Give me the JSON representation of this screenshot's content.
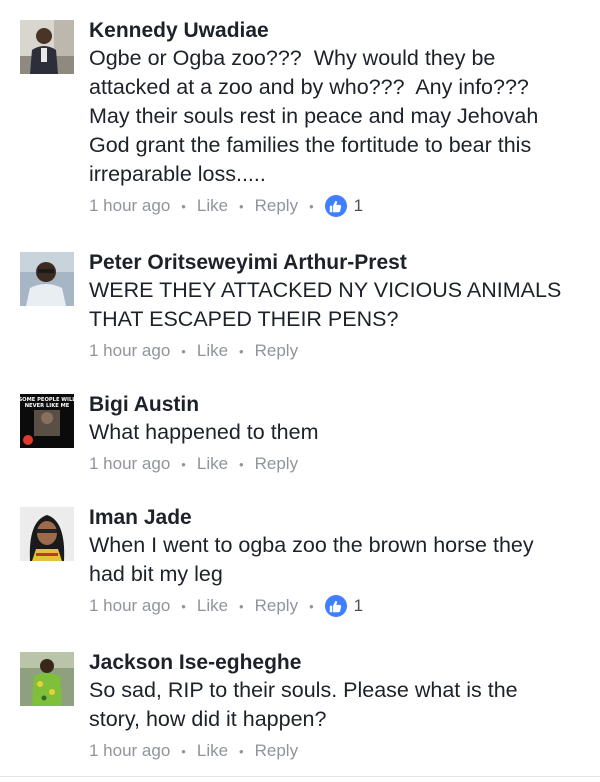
{
  "accent_color": "#4080ff",
  "comments": [
    {
      "author": "Kennedy Uwadiae",
      "text": "Ogbe or Ogba zoo???  Why would they be\nattacked at a zoo and by who???  Any info???\nMay their souls rest in peace and may Jehovah\nGod grant the families the fortitude to bear this\nirreparable loss.....",
      "time": "1 hour ago",
      "like_label": "Like",
      "reply_label": "Reply",
      "reactions": "1",
      "avatar_icon": "profile-photo-man-office"
    },
    {
      "author": "Peter Oritseweyimi Arthur-Prest",
      "text": "WERE THEY ATTACKED NY VICIOUS ANIMALS\nTHAT ESCAPED THEIR PENS?",
      "time": "1 hour ago",
      "like_label": "Like",
      "reply_label": "Reply",
      "avatar_icon": "profile-photo-man-glasses"
    },
    {
      "author": "Bigi Austin",
      "text": "What happened to them",
      "time": "1 hour ago",
      "like_label": "Like",
      "reply_label": "Reply",
      "avatar_icon": "profile-photo-meme",
      "avatar_caption": "SOME PEOPLE WILL NEVER LIKE ME"
    },
    {
      "author": "Iman Jade",
      "text": "When I went to ogba zoo the brown horse they\nhad bit my leg",
      "time": "1 hour ago",
      "like_label": "Like",
      "reply_label": "Reply",
      "reactions": "1",
      "avatar_icon": "profile-photo-woman"
    },
    {
      "author": "Jackson Ise-egheghe",
      "text": "So sad, RIP to their souls. Please what is the\nstory, how did it happen?",
      "time": "1 hour ago",
      "like_label": "Like",
      "reply_label": "Reply",
      "avatar_icon": "profile-photo-man-green"
    }
  ]
}
